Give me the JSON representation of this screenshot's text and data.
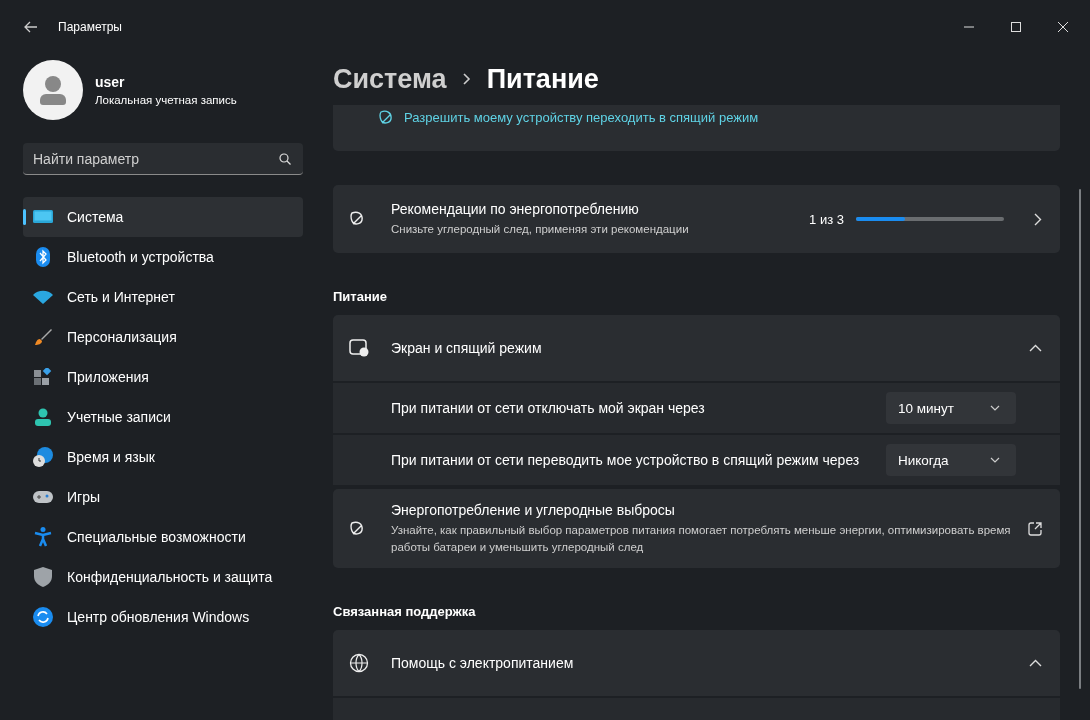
{
  "window": {
    "title": "Параметры"
  },
  "account": {
    "name": "user",
    "type": "Локальная учетная запись"
  },
  "search": {
    "placeholder": "Найти параметр"
  },
  "sidebar": {
    "items": [
      {
        "label": "Система",
        "selected": true
      },
      {
        "label": "Bluetooth и устройства",
        "selected": false
      },
      {
        "label": "Сеть и Интернет",
        "selected": false
      },
      {
        "label": "Персонализация",
        "selected": false
      },
      {
        "label": "Приложения",
        "selected": false
      },
      {
        "label": "Учетные записи",
        "selected": false
      },
      {
        "label": "Время и язык",
        "selected": false
      },
      {
        "label": "Игры",
        "selected": false
      },
      {
        "label": "Специальные возможности",
        "selected": false
      },
      {
        "label": "Конфиденциальность и защита",
        "selected": false
      },
      {
        "label": "Центр обновления Windows",
        "selected": false
      }
    ]
  },
  "breadcrumb": {
    "parent": "Система",
    "current": "Питание"
  },
  "sleep_link": "Разрешить моему устройству переходить в спящий режим",
  "recommendations": {
    "title": "Рекомендации по энергопотреблению",
    "subtitle": "Снизьте углеродный след, применяя эти рекомендации",
    "count": "1 из 3",
    "level": 0.33
  },
  "power_section": {
    "heading": "Питание",
    "screen_sleep": {
      "title": "Экран и спящий режим",
      "expanded": true,
      "settings": [
        {
          "label": "При питании от сети отключать мой экран через",
          "value": "10 минут"
        },
        {
          "label": "При питании от сети переводить мое устройство в спящий режим через",
          "value": "Никогда"
        }
      ]
    },
    "energy": {
      "title": "Энергопотребление и углеродные выбросы",
      "description": "Узнайте, как правильный выбор параметров питания помогает потреблять меньше энергии, оптимизировать время работы батареи и уменьшить углеродный след"
    }
  },
  "support_section": {
    "heading": "Связанная поддержка",
    "help": {
      "title": "Помощь с электропитанием",
      "expanded": true
    }
  }
}
